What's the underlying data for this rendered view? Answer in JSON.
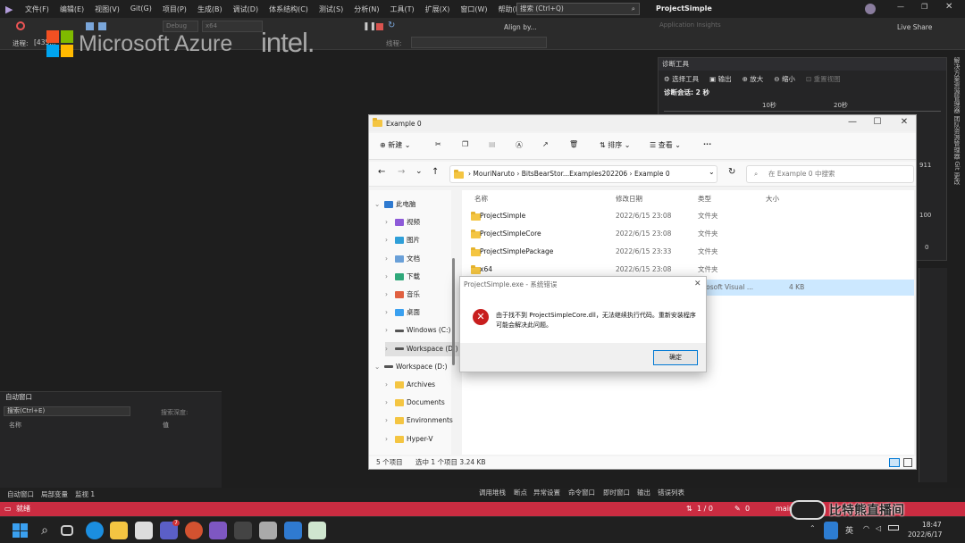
{
  "vs": {
    "menu": [
      "文件(F)",
      "编辑(E)",
      "视图(V)",
      "Git(G)",
      "项目(P)",
      "生成(B)",
      "调试(D)",
      "体系结构(C)",
      "测试(S)",
      "分析(N)",
      "工具(T)",
      "扩展(X)",
      "窗口(W)",
      "帮助(H)"
    ],
    "search_placeholder": "搜索 (Ctrl+Q)",
    "solution_name": "ProjectSimple",
    "live_share": "Live Share",
    "align_by": "Align by...",
    "app_insights": "Application Insights",
    "debug_label": "Debug",
    "platform_label": "x64",
    "process_label": "进程:",
    "process_value": "[435...",
    "thread_label": "线程:"
  },
  "sponsor": {
    "azure": "Microsoft Azure",
    "intel": "intel."
  },
  "diag": {
    "title": "诊断工具",
    "select_tool": "选择工具",
    "output": "输出",
    "zoom_in": "放大",
    "zoom_out": "缩小",
    "reset_view": "重置视图",
    "session": "诊断会话: 2 秒",
    "t10": "10秒",
    "t20": "20秒",
    "v911": "911",
    "v100": "100",
    "v0": "0"
  },
  "right_tabs": "解决方案资源管理器  团队资源管理器  Git 更改",
  "autos": {
    "title": "自动窗口",
    "search": "搜索(Ctrl+E)",
    "depth": "搜索深度:",
    "col_name": "名称",
    "col_value": "值"
  },
  "bottom_tabs_left": [
    "自动窗口",
    "局部变量",
    "监视 1"
  ],
  "bottom_tabs_right": [
    "调用堆栈",
    "断点",
    "异常设置",
    "命令窗口",
    "即时窗口",
    "输出",
    "错误列表"
  ],
  "statusbar": {
    "ready": "就绪",
    "position": "1 / 0",
    "edits": "0",
    "branch": "main"
  },
  "explorer": {
    "title": "Example 0",
    "cmd_new": "新建",
    "cmd_sort": "排序",
    "cmd_view": "查看",
    "breadcrumb": [
      "MouriNaruto",
      "BitsBearStor...Examples202206",
      "Example 0"
    ],
    "search_placeholder": "在 Example 0 中搜索",
    "nav": [
      {
        "label": "此电脑",
        "type": "pc"
      },
      {
        "label": "视频",
        "type": "video"
      },
      {
        "label": "图片",
        "type": "pictures"
      },
      {
        "label": "文档",
        "type": "documents"
      },
      {
        "label": "下载",
        "type": "downloads"
      },
      {
        "label": "音乐",
        "type": "music"
      },
      {
        "label": "桌面",
        "type": "desktop"
      },
      {
        "label": "Windows (C:)",
        "type": "drive"
      },
      {
        "label": "Workspace (D:)",
        "type": "drive"
      },
      {
        "label": "Workspace (D:)",
        "type": "drive"
      },
      {
        "label": "Archives",
        "type": "folder"
      },
      {
        "label": "Documents",
        "type": "folder"
      },
      {
        "label": "Environments",
        "type": "folder"
      },
      {
        "label": "Hyper-V",
        "type": "folder"
      }
    ],
    "columns": {
      "name": "名称",
      "date": "修改日期",
      "type": "类型",
      "size": "大小"
    },
    "files": [
      {
        "name": "ProjectSimple",
        "date": "2022/6/15 23:08",
        "type": "文件夹",
        "size": ""
      },
      {
        "name": "ProjectSimpleCore",
        "date": "2022/6/15 23:08",
        "type": "文件夹",
        "size": ""
      },
      {
        "name": "ProjectSimplePackage",
        "date": "2022/6/15 23:33",
        "type": "文件夹",
        "size": ""
      },
      {
        "name": "x64",
        "date": "2022/6/15 23:08",
        "type": "文件夹",
        "size": ""
      },
      {
        "name": "",
        "date": "",
        "type": "icrosoft Visual ...",
        "size": "4 KB"
      }
    ],
    "status_count": "5 个项目",
    "status_selected": "选中 1 个项目  3.24 KB"
  },
  "error": {
    "title": "ProjectSimple.exe - 系统错误",
    "message": "由于找不到 ProjectSimpleCore.dll，无法继续执行代码。重新安装程序可能会解决此问题。",
    "ok": "确定"
  },
  "taskbar": {
    "lang": "英",
    "time": "18:47",
    "date": "2022/6/17",
    "badge": "7"
  },
  "watermark": "比特熊直播间"
}
